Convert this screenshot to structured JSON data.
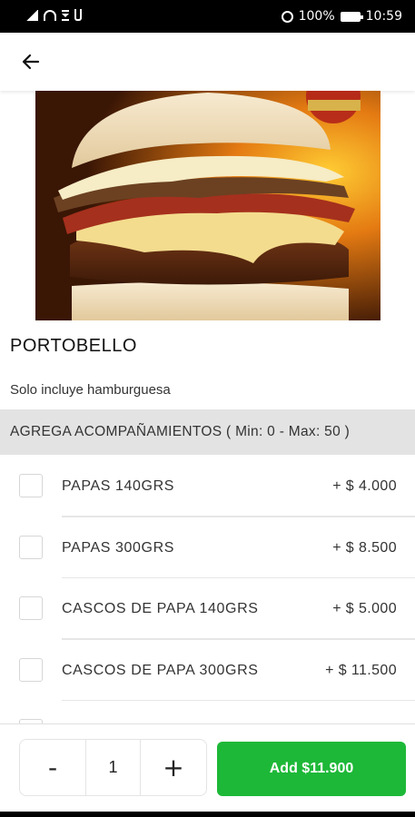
{
  "status_bar": {
    "battery": "100%",
    "time": "10:59"
  },
  "icons": {
    "back": "arrow-left-icon",
    "minus": "minus-icon",
    "plus": "plus-icon"
  },
  "product": {
    "name": "PORTOBELLO",
    "description": "Solo incluye hamburguesa"
  },
  "section": {
    "title": "AGREGA ACOMPAÑAMIENTOS ( Min: 0 - Max: 50 )"
  },
  "options": [
    {
      "label": "PAPAS 140GRS",
      "price": "+ $ 4.000",
      "checked": false
    },
    {
      "label": "PAPAS 300GRS",
      "price": "+ $ 8.500",
      "checked": false
    },
    {
      "label": "CASCOS DE PAPA 140GRS",
      "price": "+ $ 5.000",
      "checked": false
    },
    {
      "label": "CASCOS DE PAPA 300GRS",
      "price": "+ $ 11.500",
      "checked": false
    }
  ],
  "cart": {
    "minus_label": "-",
    "quantity": "1",
    "plus_label": "+",
    "add_label": "Add $11.900"
  },
  "colors": {
    "accent_green": "#1db838",
    "section_bg": "#e3e3e3"
  }
}
